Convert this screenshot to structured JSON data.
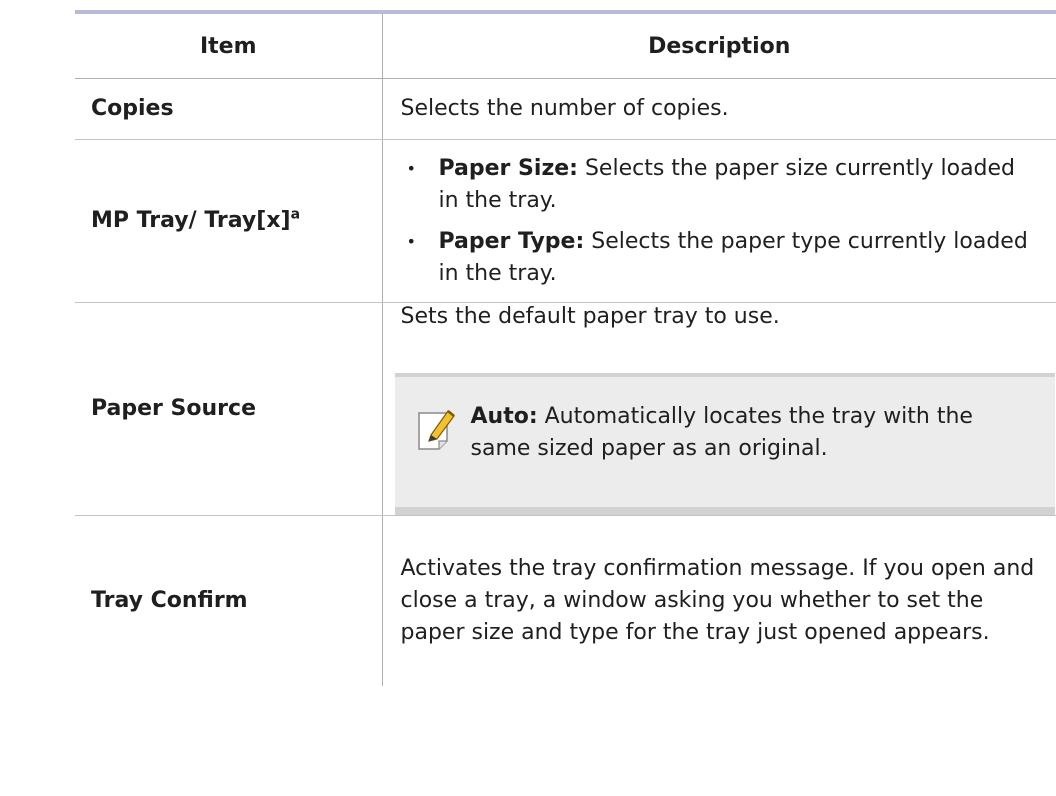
{
  "header": {
    "item": "Item",
    "description": "Description"
  },
  "rows": {
    "copies": {
      "item": "Copies",
      "desc": "Selects the number of copies."
    },
    "tray": {
      "item": "MP Tray/ Tray[x]",
      "item_sup": "a",
      "bullets": [
        {
          "label": "Paper Size:",
          "text": " Selects the paper size currently loaded in the tray."
        },
        {
          "label": "Paper Type:",
          "text": " Selects the paper type currently loaded in the tray."
        }
      ]
    },
    "source": {
      "item": "Paper Source",
      "desc": "Sets the default paper tray to use.",
      "note_label": "Auto:",
      "note_text": " Automatically locates the tray with the same sized paper as an original.",
      "note_icon": "note-pencil-icon"
    },
    "confirm": {
      "item": "Tray Confirm",
      "desc": "Activates the tray confirmation message. If you open and close a tray, a window asking you whether to set the paper size and type for the tray just opened appears."
    }
  }
}
